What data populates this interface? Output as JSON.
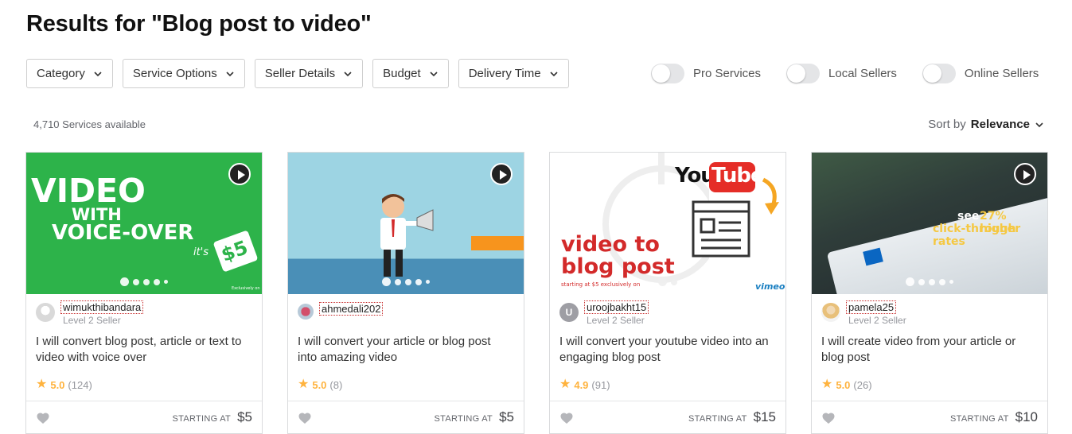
{
  "page": {
    "title": "Results for \"Blog post to video\""
  },
  "filters": [
    "Category",
    "Service Options",
    "Seller Details",
    "Budget",
    "Delivery Time"
  ],
  "toggles": [
    "Pro Services",
    "Local Sellers",
    "Online Sellers"
  ],
  "results": {
    "available": "4,710 Services available"
  },
  "sort": {
    "label": "Sort by",
    "value": "Relevance"
  },
  "gigs": [
    {
      "seller": "wimukthibandara",
      "level": "Level 2 Seller",
      "title": "I will convert blog post, article or text to video with voice over",
      "rating": "5.0",
      "reviews": "(124)",
      "starting_label": "STARTING AT",
      "price": "$5",
      "thumb": {
        "line1": "VIDEO",
        "line2": "WITH",
        "line3": "VOICE-OVER",
        "tag_small": "it's",
        "tag_price": "$5",
        "credit": "Exclusively on"
      }
    },
    {
      "seller": "ahmedali202",
      "level": "",
      "title": "I will convert your article or blog post into amazing video",
      "rating": "5.0",
      "reviews": "(8)",
      "starting_label": "STARTING AT",
      "price": "$5",
      "thumb": {}
    },
    {
      "seller": "uroojbakht15",
      "level": "Level 2 Seller",
      "title": "I will convert your youtube video into an engaging blog post",
      "rating": "4.9",
      "reviews": "(91)",
      "starting_label": "STARTING AT",
      "price": "$15",
      "thumb": {
        "youtube_you": "You",
        "youtube_tube": "Tube",
        "caption1": "video to",
        "caption2": "blog post",
        "small": "starting at $5 exclusively on",
        "brand": "vimeo"
      }
    },
    {
      "seller": "pamela25",
      "level": "Level 2 Seller",
      "title": "I will create video from your article or blog post",
      "rating": "5.0",
      "reviews": "(26)",
      "starting_label": "STARTING AT",
      "price": "$10",
      "thumb": {
        "line1": "see",
        "highlight": "27% higher",
        "line2": "click-through rates"
      }
    }
  ],
  "colors": {
    "green": "#2db34a",
    "sky": "#9dd4e3",
    "red": "#d32a2a",
    "star": "#ffb33e"
  },
  "icons": {
    "play": "play-icon",
    "heart": "heart-icon",
    "chevron": "chevron-down-icon",
    "star": "star-icon"
  }
}
